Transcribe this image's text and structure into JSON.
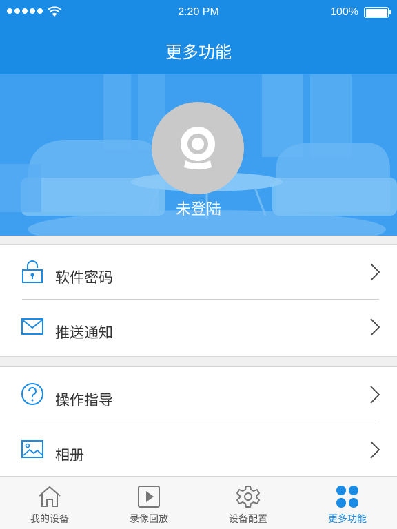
{
  "status_bar": {
    "time": "2:20 PM",
    "battery": "100%"
  },
  "header": {
    "title": "更多功能"
  },
  "profile": {
    "login_status": "未登陆"
  },
  "menu_groups": [
    {
      "items": [
        {
          "label": "软件密码",
          "icon": "lock-icon"
        },
        {
          "label": "推送通知",
          "icon": "mail-icon"
        }
      ]
    },
    {
      "items": [
        {
          "label": "操作指导",
          "icon": "help-icon"
        },
        {
          "label": "相册",
          "icon": "image-icon"
        }
      ]
    }
  ],
  "tab_bar": {
    "tabs": [
      {
        "label": "我的设备",
        "icon": "home-icon",
        "active": false
      },
      {
        "label": "录像回放",
        "icon": "play-icon",
        "active": false
      },
      {
        "label": "设备配置",
        "icon": "gear-icon",
        "active": false
      },
      {
        "label": "更多功能",
        "icon": "more-icon",
        "active": true
      }
    ]
  },
  "colors": {
    "accent": "#1a8ce6",
    "icon_gray": "#777777",
    "text": "#333333"
  }
}
